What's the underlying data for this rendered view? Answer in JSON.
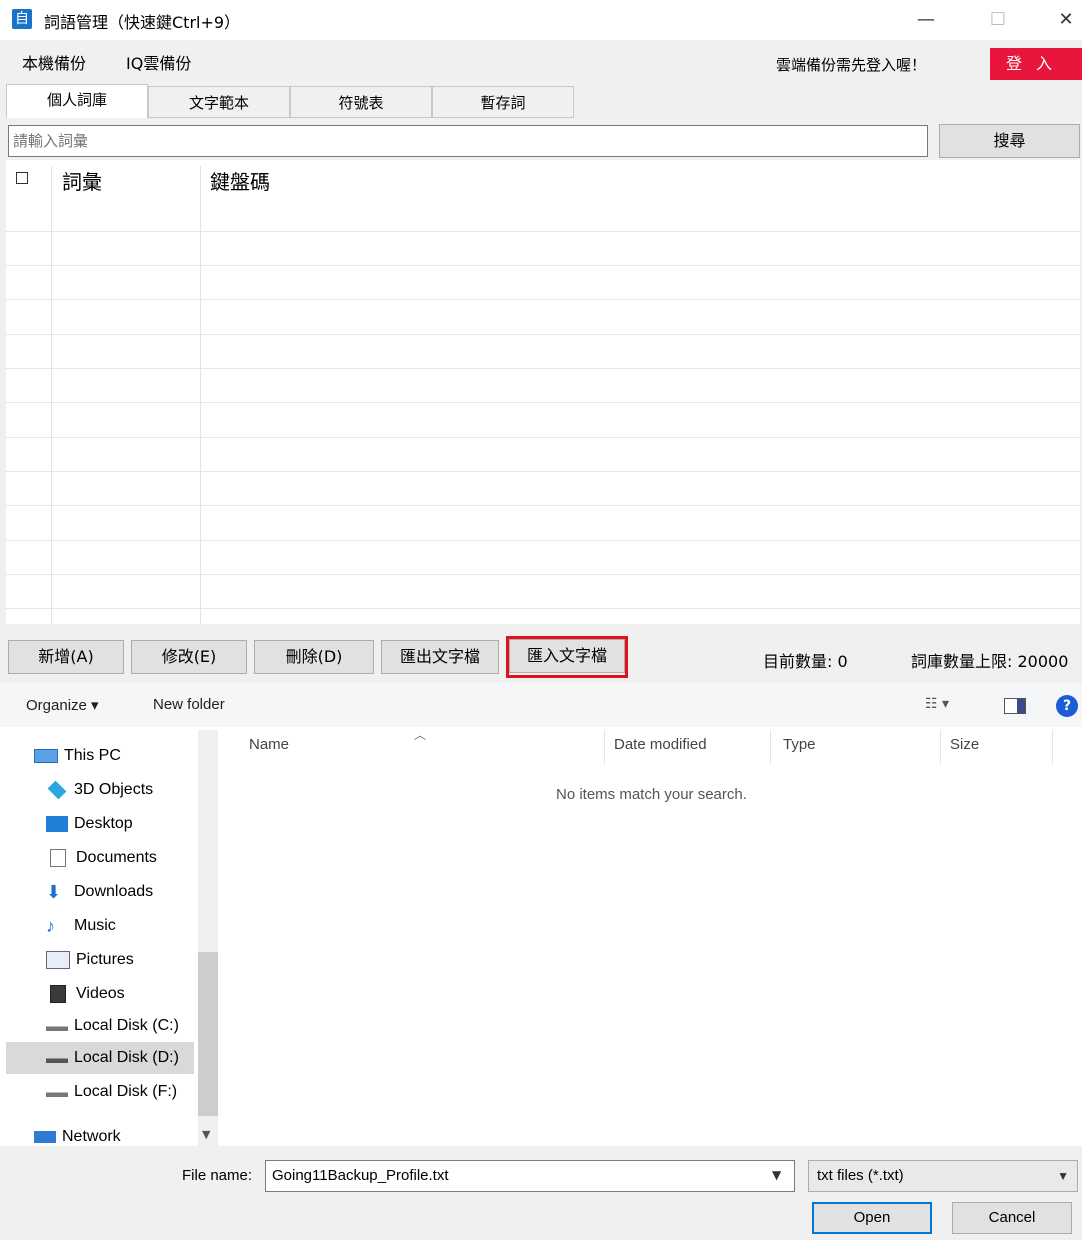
{
  "window": {
    "app_icon_text": "自",
    "title": "詞語管理（快速鍵Ctrl+9）",
    "minimize": "—",
    "maximize": "☐",
    "close": "✕"
  },
  "menu": {
    "items": [
      "本機備份",
      "IQ雲備份"
    ],
    "cloud_message": "雲端備份需先登入喔！",
    "login_label": "登入"
  },
  "tabs": [
    "個人詞庫",
    "文字範本",
    "符號表",
    "暫存詞"
  ],
  "search": {
    "placeholder": "請輸入詞彙",
    "button": "搜尋"
  },
  "table": {
    "checkbox_symbol": "□",
    "columns": [
      "詞彙",
      "鍵盤碼"
    ],
    "rows": []
  },
  "actions": {
    "add": "新增(A)",
    "edit": "修改(E)",
    "delete": "刪除(D)",
    "export": "匯出文字檔",
    "import": "匯入文字檔"
  },
  "counts": {
    "current": "目前數量: 0",
    "limit": "詞庫數量上限: 20000"
  },
  "dialog": {
    "organize": "Organize ▾",
    "new_folder": "New folder",
    "help": "?",
    "view_icon": "☷ ▾",
    "nav_items": [
      {
        "label": "This PC",
        "icon": "pc-icon"
      },
      {
        "label": "3D Objects",
        "icon": "cube-icon"
      },
      {
        "label": "Desktop",
        "icon": "desktop-icon"
      },
      {
        "label": "Documents",
        "icon": "document-icon"
      },
      {
        "label": "Downloads",
        "icon": "download-icon"
      },
      {
        "label": "Music",
        "icon": "music-icon"
      },
      {
        "label": "Pictures",
        "icon": "pictures-icon"
      },
      {
        "label": "Videos",
        "icon": "video-icon"
      },
      {
        "label": "Local Disk (C:)",
        "icon": "disk-icon"
      },
      {
        "label": "Local Disk (D:)",
        "icon": "disk-icon",
        "selected": true
      },
      {
        "label": "Local Disk (F:)",
        "icon": "disk-icon"
      },
      {
        "label": "Network",
        "icon": "network-icon"
      }
    ],
    "columns": [
      "Name",
      "Date modified",
      "Type",
      "Size"
    ],
    "empty_message": "No items match your search.",
    "file_name_label": "File name:",
    "file_name_value": "Going11Backup_Profile.txt",
    "file_type": "txt files (*.txt)",
    "open": "Open",
    "cancel": "Cancel"
  }
}
